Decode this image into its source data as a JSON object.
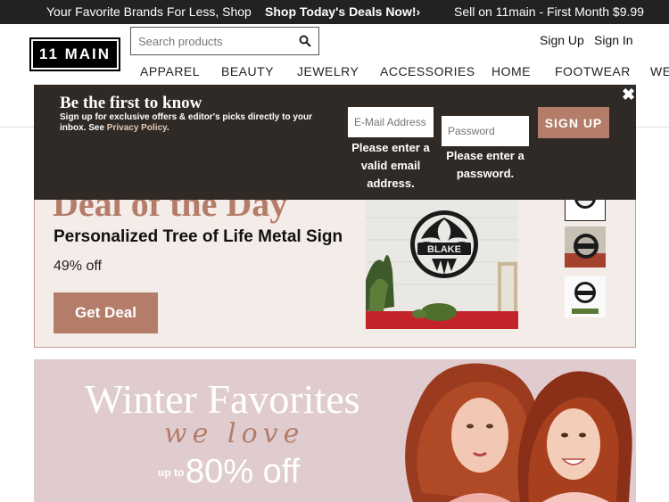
{
  "topbar": {
    "left": "Your Favorite Brands For Less, Shop",
    "center": "Shop Today's Deals Now!›",
    "right": "Sell on 11main - First Month $9.99"
  },
  "logo": {
    "text": "11 MAIN"
  },
  "search": {
    "placeholder": "Search products",
    "value": ""
  },
  "account": {
    "signup": "Sign Up",
    "signin": "Sign In"
  },
  "nav": [
    "APPAREL",
    "BEAUTY",
    "JEWELRY",
    "ACCESSORIES",
    "HOME",
    "FOOTWEAR",
    "WE"
  ],
  "popup": {
    "title": "Be the first to know",
    "desc": "Sign up for exclusive offers & editor's picks directly to your inbox. See ",
    "privacy": "Privacy Policy",
    "email_placeholder": "E-Mail Address",
    "password_placeholder": "Password",
    "button": "SIGN UP",
    "email_error": "Please enter a valid email address.",
    "password_error": "Please enter a password.",
    "close": "✖"
  },
  "deal": {
    "heading": "Deal of the Day",
    "title": "Personalized Tree of Life Metal Sign",
    "discount": "49% off",
    "button": "Get Deal",
    "sign_text": "BLAKE"
  },
  "promo": {
    "title": "Winter Favorites",
    "script": "we love",
    "upto": "up to",
    "discount": "80% off"
  },
  "colors": {
    "accent": "#b47d6a",
    "popup_bg": "#2f2a26",
    "deal_bg": "#f4ece8",
    "promo_bg": "#e0ccce"
  }
}
